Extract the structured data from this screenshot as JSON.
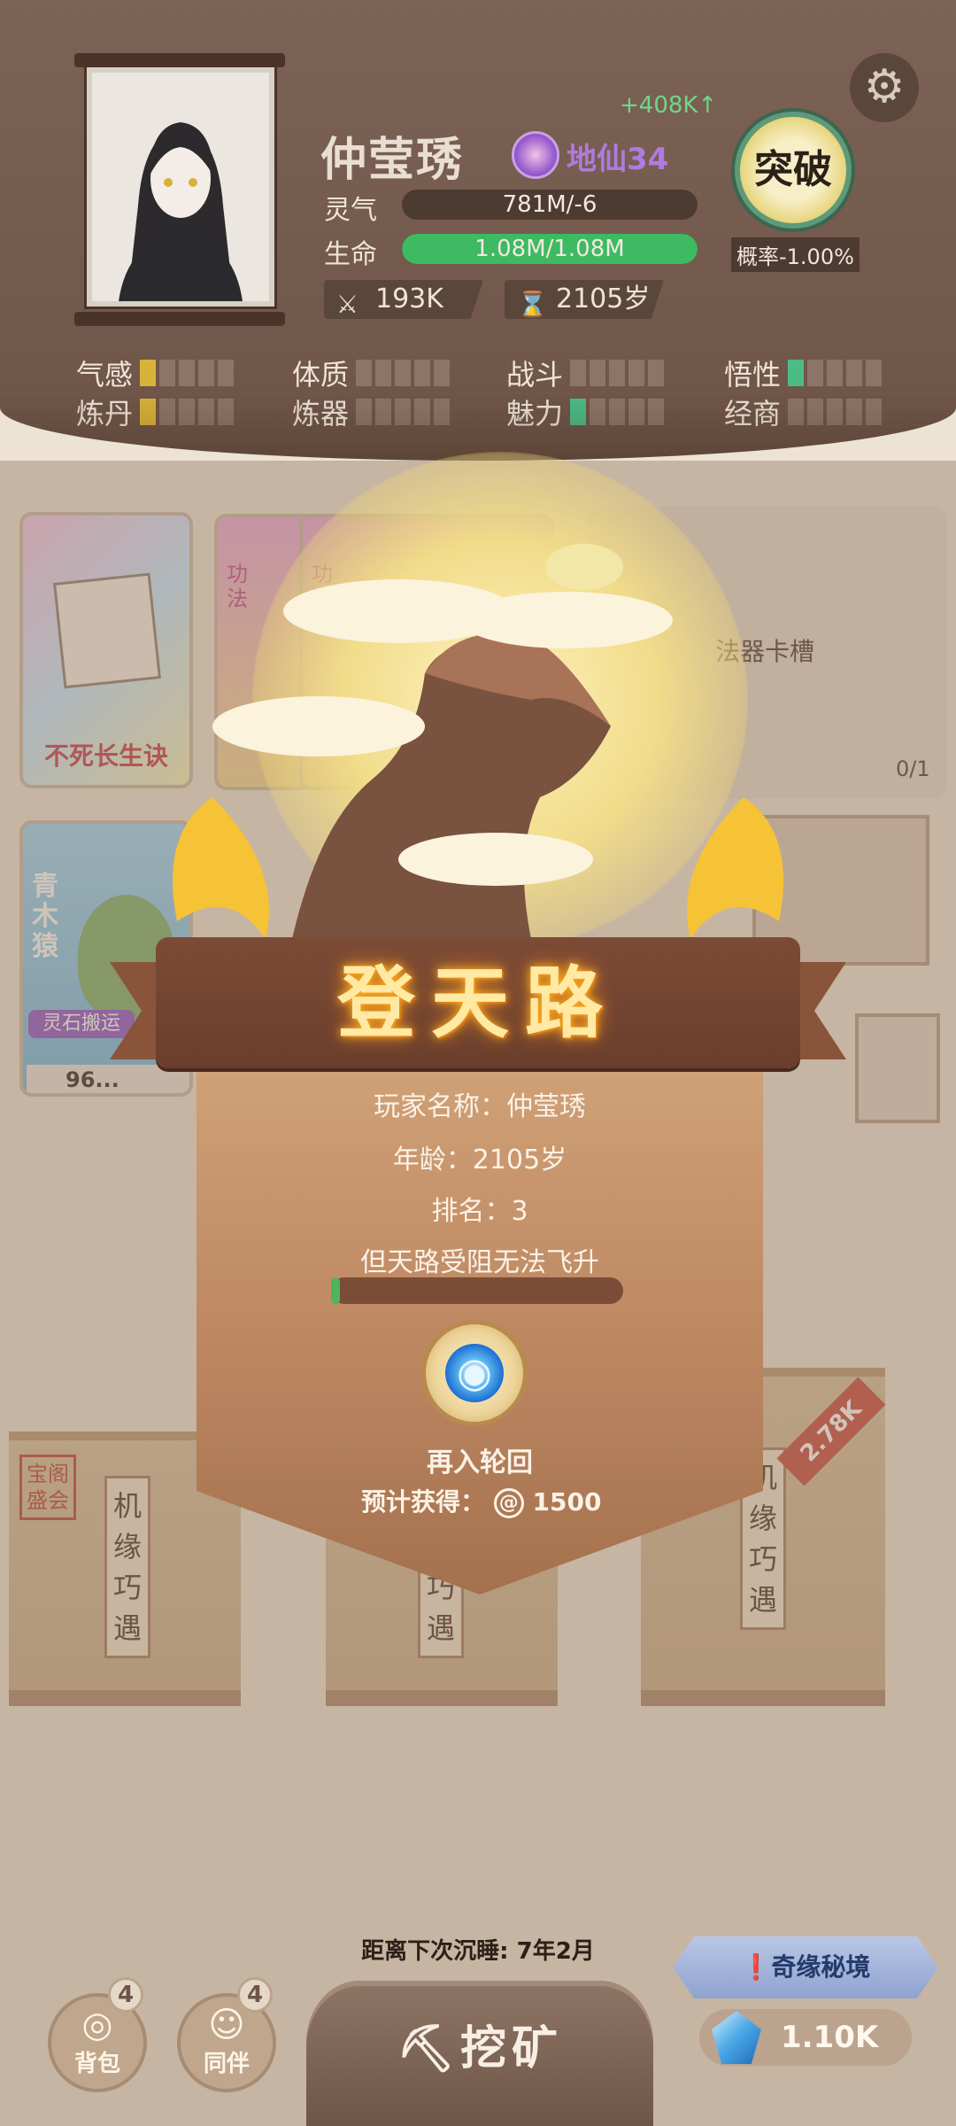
{
  "player": {
    "name": "仲莹琇",
    "realm": "地仙34",
    "gain": "+408K↑",
    "stats": [
      {
        "label": "灵气",
        "value": "781M/-6",
        "fill": 0.0
      },
      {
        "label": "生命",
        "value": "1.08M/1.08M",
        "fill": 1.0
      }
    ],
    "power": "193K",
    "age": "2105岁",
    "breakthrough": {
      "label": "突破",
      "rate": "概率-1.00%"
    }
  },
  "attributes": [
    {
      "label": "气感",
      "level": 1,
      "color": "#d9b23a"
    },
    {
      "label": "体质",
      "level": 0,
      "color": "#d9b23a"
    },
    {
      "label": "战斗",
      "level": 0,
      "color": "#d9b23a"
    },
    {
      "label": "悟性",
      "level": 1,
      "color": "#4dbb86"
    },
    {
      "label": "炼丹",
      "level": 1,
      "color": "#d9b23a"
    },
    {
      "label": "炼器",
      "level": 0,
      "color": "#d9b23a"
    },
    {
      "label": "魅力",
      "level": 1,
      "color": "#4dbb86"
    },
    {
      "label": "经商",
      "level": 0,
      "color": "#d9b23a"
    }
  ],
  "cards": {
    "technique_main": "不死长生诀",
    "skill_tag": "功法",
    "slot_label": "法器卡槽",
    "slot_count": "0/1",
    "pet_name": "青木猿",
    "pet_skill": "灵石搬运",
    "pet_power": "96..."
  },
  "bags": {
    "left_stamp": "宝阁盛会",
    "label": "机缘巧遇",
    "price": "2.78K"
  },
  "modal": {
    "title": "登天路",
    "player_line": "玩家名称：仲莹琇",
    "age_line": "年龄：2105岁",
    "rank_line": "排名：3",
    "status_line": "但天路受阻无法飞升",
    "progress": 0.03,
    "action_label": "再入轮回",
    "reward_prefix": "预计获得：",
    "reward_value": "1500"
  },
  "footer": {
    "sleep_text": "距离下次沉睡: 7年2月",
    "bag_label": "背包",
    "bag_badge": "4",
    "companion_label": "同伴",
    "companion_badge": "4",
    "mine_label": "挖矿",
    "secret_label": "奇缘秘境",
    "currency": "1.10K"
  },
  "icons": {
    "settings": "gear-icon",
    "power": "crossed-swords-icon",
    "age": "hourglass-icon",
    "mine": "pickaxe-icon"
  }
}
